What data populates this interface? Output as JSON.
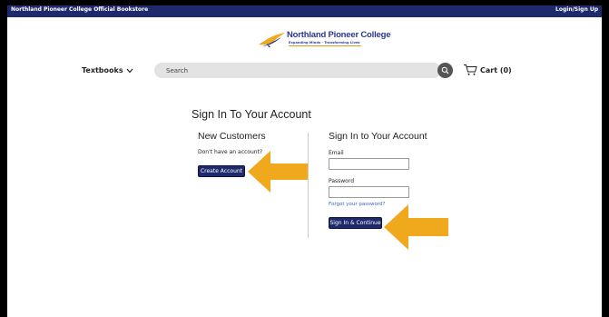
{
  "topbar": {
    "store_name": "Northland Pioneer College Official Bookstore",
    "login_label": "Login/Sign Up"
  },
  "logo": {
    "name": "Northland Pioneer College",
    "tagline": "Expanding Minds · Transforming Lives"
  },
  "nav": {
    "textbooks_label": "Textbooks",
    "search_placeholder": "Search",
    "cart_label": "Cart (0)"
  },
  "signin": {
    "title": "Sign In To Your Account"
  },
  "new_customers": {
    "title": "New Customers",
    "prompt": "Don't have an account?",
    "create_button": "Create Account"
  },
  "account": {
    "title": "Sign In to Your Account",
    "email_label": "Email",
    "password_label": "Password",
    "forgot_link": "Forgot your password?",
    "continue_button": "Sign In & Continue"
  },
  "colors": {
    "brand_navy": "#1e2a6b",
    "arrow_gold": "#f0a81c",
    "link_blue": "#3766c8"
  },
  "icons": {
    "search": "magnifier-icon",
    "cart": "cart-icon",
    "dropdown": "chevron-down-icon",
    "logo": "bird-logo-icon"
  }
}
